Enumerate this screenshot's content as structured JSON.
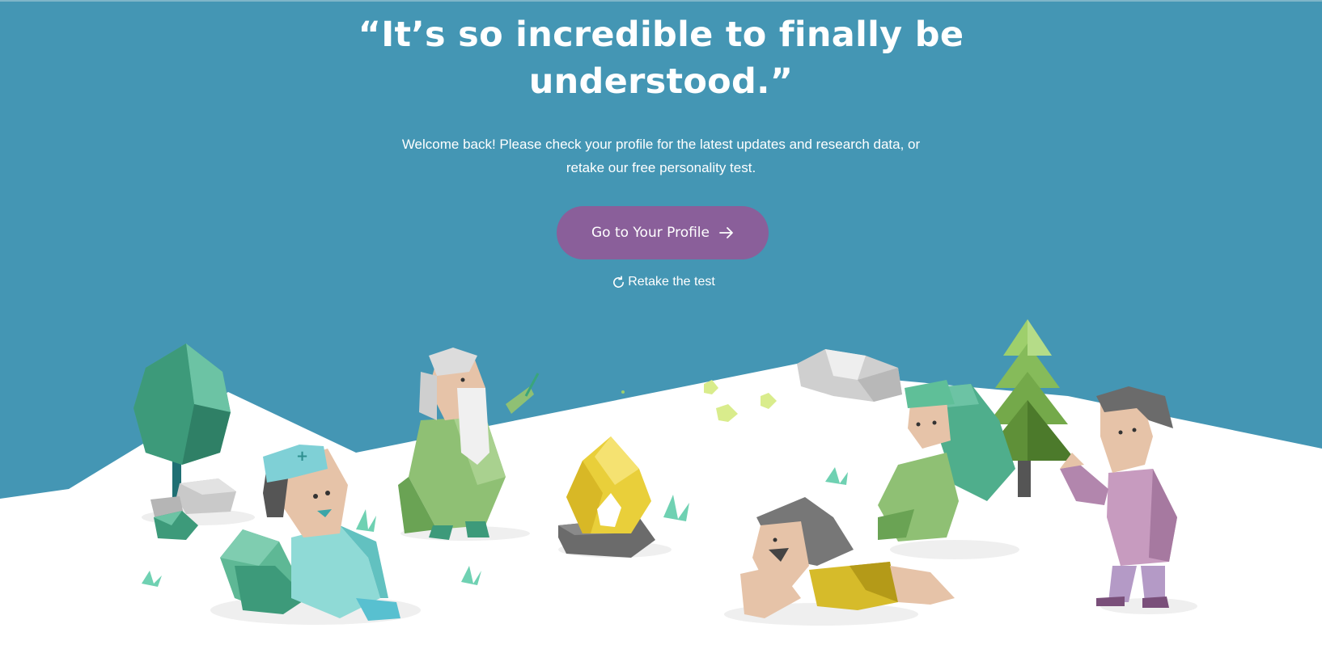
{
  "hero": {
    "headline": "“It’s so incredible to finally be understood.”",
    "subtext": "Welcome back! Please check your profile for the latest updates and research data, or retake our free personality test."
  },
  "actions": {
    "profile_button_label": "Go to Your Profile",
    "profile_button_icon": "arrow-right-icon",
    "retake_label": "Retake the test",
    "retake_icon": "refresh-icon"
  },
  "colors": {
    "sky": "#4496b4",
    "snow": "#ffffff",
    "button": "#8a5f9a",
    "text": "#ffffff"
  },
  "illustration": {
    "characters": [
      "nurse-character",
      "elder-wizard-character",
      "campfire",
      "lying-woman-character",
      "green-hooded-character",
      "man-in-pink-suit-character"
    ],
    "scenery": [
      "round-tree",
      "pine-tree",
      "rocks",
      "grass-tufts",
      "small-flowers"
    ]
  }
}
